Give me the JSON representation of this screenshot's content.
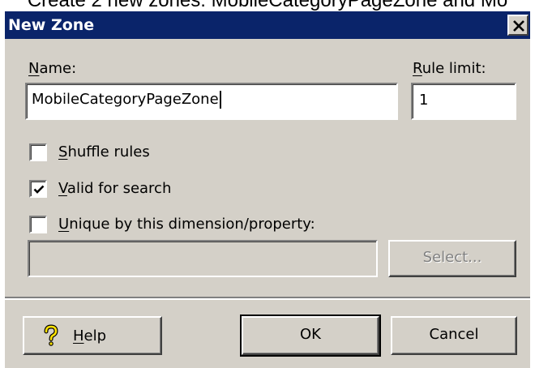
{
  "caption": "Create 2 new zones: MobileCategoryPageZone and Mo",
  "dialog": {
    "title": "New Zone",
    "close_glyph": "✕"
  },
  "form": {
    "name_label_mnemonic": "N",
    "name_label_rest": "ame:",
    "name_value": "MobileCategoryPageZone",
    "rule_limit_label_mnemonic": "R",
    "rule_limit_label_rest": "ule limit:",
    "rule_limit_value": "1"
  },
  "options": {
    "shuffle": {
      "mnemonic": "S",
      "rest": "huffle rules",
      "checked": false
    },
    "valid_search": {
      "mnemonic": "V",
      "rest": "alid for search",
      "checked": true
    },
    "unique": {
      "mnemonic": "U",
      "rest": "nique by this dimension/property:",
      "checked": false
    },
    "property_value": "",
    "select_label": "Select..."
  },
  "footer": {
    "help_mnemonic": "H",
    "help_rest": "elp",
    "help_icon": "question-mark-icon",
    "ok_label": "OK",
    "cancel_label": "Cancel"
  },
  "colors": {
    "titlebar": "#0a246a",
    "face": "#d4d0c8"
  }
}
